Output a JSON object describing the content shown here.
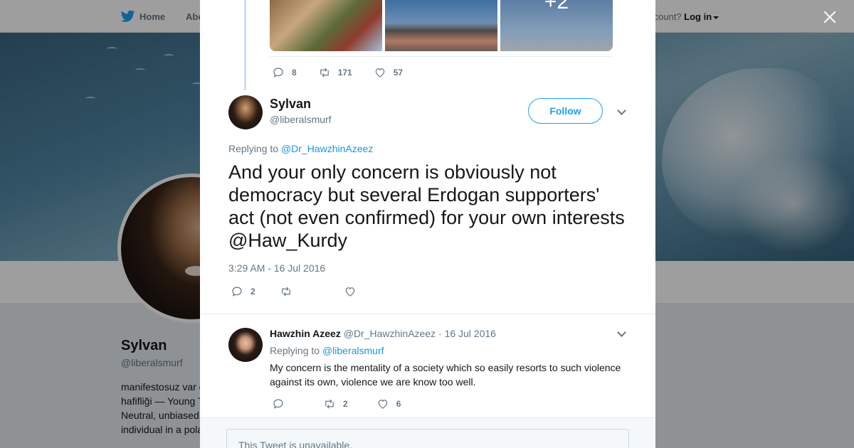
{
  "topnav": {
    "home_label": "Home",
    "about_label": "Abo",
    "account_prompt": "ccount?",
    "login_label": "Log in"
  },
  "profile": {
    "name": "Sylvan",
    "handle": "@liberalsmurf",
    "bio_lines": [
      "manifestosuz var o",
      "hafifliği — Young T",
      "Neutral, unbiased",
      "individual in a pola"
    ]
  },
  "previous_tweet": {
    "media_more_label": "+2",
    "replies": "8",
    "retweets": "171",
    "likes": "57"
  },
  "tweet": {
    "author_name": "Sylvan",
    "author_handle": "@liberalsmurf",
    "follow_label": "Follow",
    "replying_prefix": "Replying to",
    "replying_to": "@Dr_HawzhinAzeez",
    "text": "And your only concern is obviously not democracy but several Erdogan supporters' act (not even confirmed) for your own interests @Haw_Kurdy",
    "timestamp": "3:29 AM - 16 Jul 2016",
    "replies": "2",
    "retweets": "",
    "likes": ""
  },
  "reply": {
    "author_name": "Hawzhin Azeez",
    "author_handle": "@Dr_HawzhinAzeez",
    "date": "16 Jul 2016",
    "replying_prefix": "Replying to",
    "replying_to": "@liberalsmurf",
    "text": "My concern is the mentality of a society which so easily resorts to such violence against its own, violence we are know too well.",
    "replies": "",
    "retweets": "2",
    "likes": "6"
  },
  "unavailable_notice": "This Tweet is unavailable.",
  "icons": {
    "brand": "twitter-bird-icon",
    "reply": "reply-icon",
    "retweet": "retweet-icon",
    "like": "heart-icon",
    "close": "close-icon",
    "more": "chevron-down-icon"
  },
  "colors": {
    "accent": "#1da1f2",
    "link": "#1b95e0",
    "muted": "#657786",
    "text": "#14171a"
  }
}
